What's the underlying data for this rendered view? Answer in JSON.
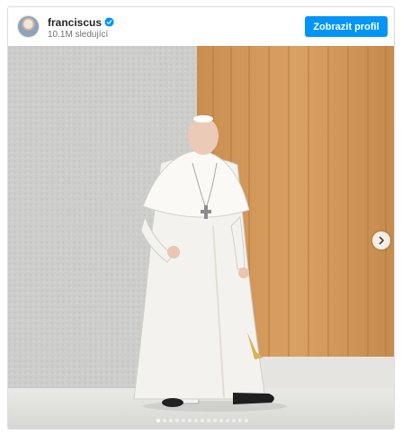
{
  "post": {
    "username": "franciscus",
    "followers": "10.1M sledující",
    "profile_button": "Zobrazit profil",
    "verified": true
  },
  "carousel": {
    "total_slides": 15,
    "current_slide": 1
  },
  "icons": {
    "verified": "verified-badge-icon",
    "next": "chevron-right-icon"
  },
  "colors": {
    "accent": "#0095f6",
    "username": "#262626",
    "secondary_text": "#737373"
  }
}
